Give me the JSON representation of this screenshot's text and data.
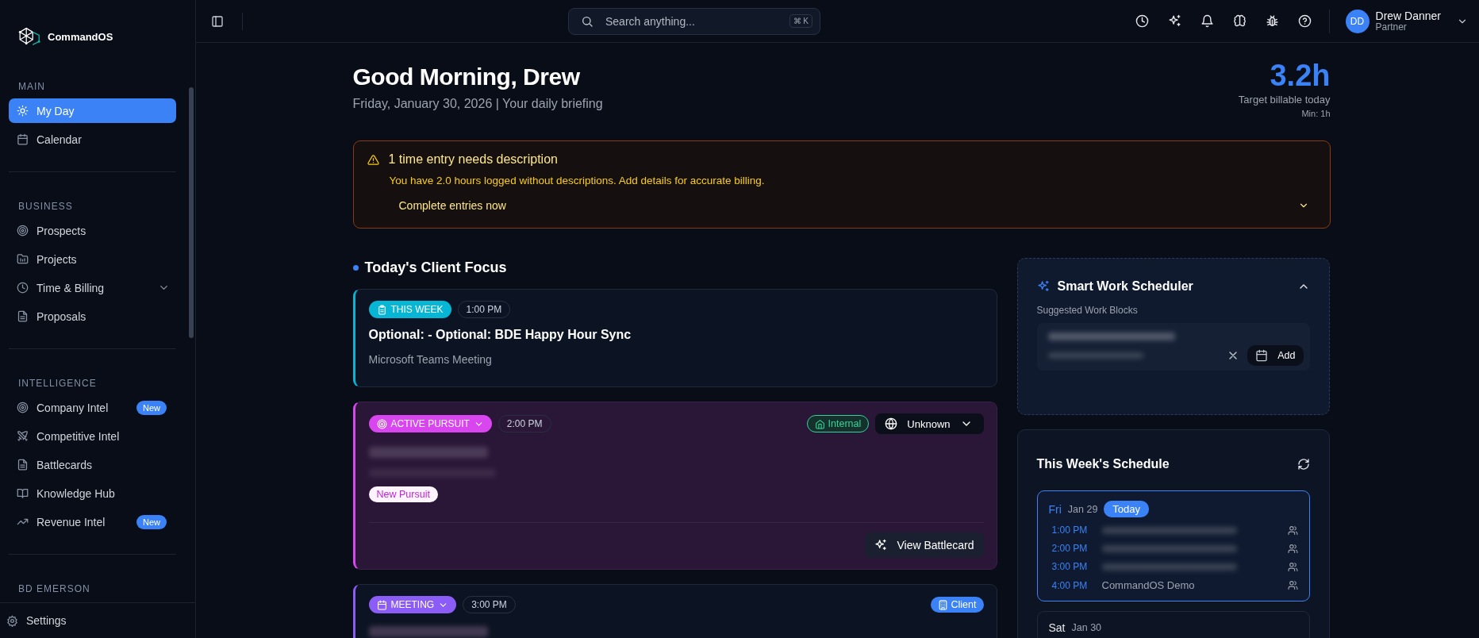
{
  "brand": {
    "name": "CommandOS"
  },
  "topbar": {
    "search": {
      "placeholder": "Search anything...",
      "shortcut": "⌘ K"
    },
    "user": {
      "initials": "DD",
      "name": "Drew Danner",
      "role": "Partner"
    }
  },
  "sidebar": {
    "sections": [
      {
        "title": "MAIN",
        "items": [
          {
            "label": "My Day",
            "kind": "link",
            "selected": true
          },
          {
            "label": "Calendar",
            "kind": "link",
            "selected": false
          }
        ]
      },
      {
        "title": "BUSINESS",
        "items": [
          {
            "label": "Prospects",
            "kind": "link",
            "selected": false
          },
          {
            "label": "Projects",
            "kind": "link",
            "selected": false
          },
          {
            "label": "Time & Billing",
            "kind": "group",
            "expanded": false,
            "selected": false
          },
          {
            "label": "Proposals",
            "kind": "link",
            "selected": false
          }
        ]
      },
      {
        "title": "INTELLIGENCE",
        "items": [
          {
            "label": "Company Intel",
            "kind": "link",
            "selected": false,
            "badge": "New"
          },
          {
            "label": "Competitive Intel",
            "kind": "link",
            "selected": false
          },
          {
            "label": "Battlecards",
            "kind": "link",
            "selected": false
          },
          {
            "label": "Knowledge Hub",
            "kind": "link",
            "selected": false
          },
          {
            "label": "Revenue Intel",
            "kind": "link",
            "selected": false,
            "badge": "New"
          }
        ]
      },
      {
        "title": "BD EMERSON"
      }
    ],
    "footer": {
      "label": "Settings"
    }
  },
  "header": {
    "greeting": "Good Morning, Drew",
    "subtitle": "Friday, January 30, 2026 | Your daily briefing",
    "target": {
      "value": "3.2h",
      "label": "Target billable today",
      "min": "Min: 1h"
    }
  },
  "alert": {
    "title": "1 time entry needs description",
    "message": "You have 2.0 hours logged without descriptions. Add details for accurate billing.",
    "action": "Complete entries now",
    "expanded": false
  },
  "focus": {
    "title": "Today's Client Focus",
    "cards": [
      {
        "kind": "event",
        "color": "#06b6d4",
        "tag": {
          "label": "THIS WEEK",
          "menu": false
        },
        "time": "1:00 PM",
        "title": "Optional: - Optional: BDE Happy Hour Sync",
        "subtitle": "Microsoft Teams Meeting"
      },
      {
        "kind": "pursuit",
        "color": "#d946ef",
        "tag": {
          "label": "ACTIVE PURSUIT",
          "menu": true
        },
        "time": "2:00 PM",
        "badge": {
          "label": "Internal",
          "kind": "internal"
        },
        "region": "Unknown",
        "chip": "New Pursuit",
        "action": "View Battlecard"
      },
      {
        "kind": "meeting",
        "color": "#8b5cf6",
        "tag": {
          "label": "MEETING",
          "menu": true
        },
        "time": "3:00 PM",
        "badge": {
          "label": "Client",
          "kind": "client"
        }
      }
    ]
  },
  "scheduler": {
    "title": "Smart Work Scheduler",
    "expanded": true,
    "subtitle": "Suggested Work Blocks",
    "blocks": [
      {
        "add_label": "Add"
      }
    ]
  },
  "schedule": {
    "title": "This Week's Schedule",
    "days": [
      {
        "day": "Fri",
        "date": "Jan 29",
        "today_label": "Today",
        "selected": true,
        "events": [
          {
            "time": "1:00 PM"
          },
          {
            "time": "2:00 PM"
          },
          {
            "time": "3:00 PM"
          },
          {
            "time": "4:00 PM",
            "title": "CommandOS Demo"
          }
        ]
      },
      {
        "day": "Sat",
        "date": "Jan 30",
        "selected": false
      }
    ]
  }
}
